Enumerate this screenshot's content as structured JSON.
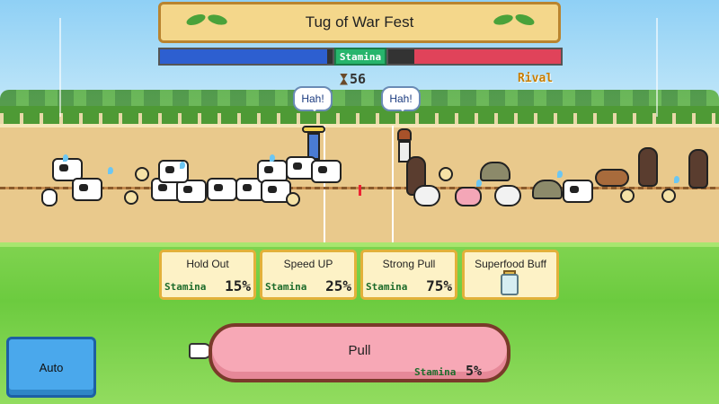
{
  "header": {
    "title": "Tug of War Fest",
    "stamina_label": "Stamina",
    "timer_value": "56",
    "rival_label": "Rival"
  },
  "stamina_bars": {
    "player_fill": 0.97,
    "rival_fill": 0.85,
    "player_color": "#2d5fd0",
    "rival_color": "#e0435a"
  },
  "speech_bubbles": [
    "Hah!",
    "Hah!"
  ],
  "skills": [
    {
      "label": "Hold Out",
      "stamina_label": "Stamina",
      "cost": "15%"
    },
    {
      "label": "Speed UP",
      "stamina_label": "Stamina",
      "cost": "25%"
    },
    {
      "label": "Strong Pull",
      "stamina_label": "Stamina",
      "cost": "75%"
    },
    {
      "label": "Superfood Buff",
      "icon": "jar-icon"
    }
  ],
  "controls": {
    "auto_label": "Auto",
    "pull_label": "Pull",
    "pull_stamina_label": "Stamina",
    "pull_cost": "5%",
    "hand_icon": "pointing-hand-icon"
  }
}
